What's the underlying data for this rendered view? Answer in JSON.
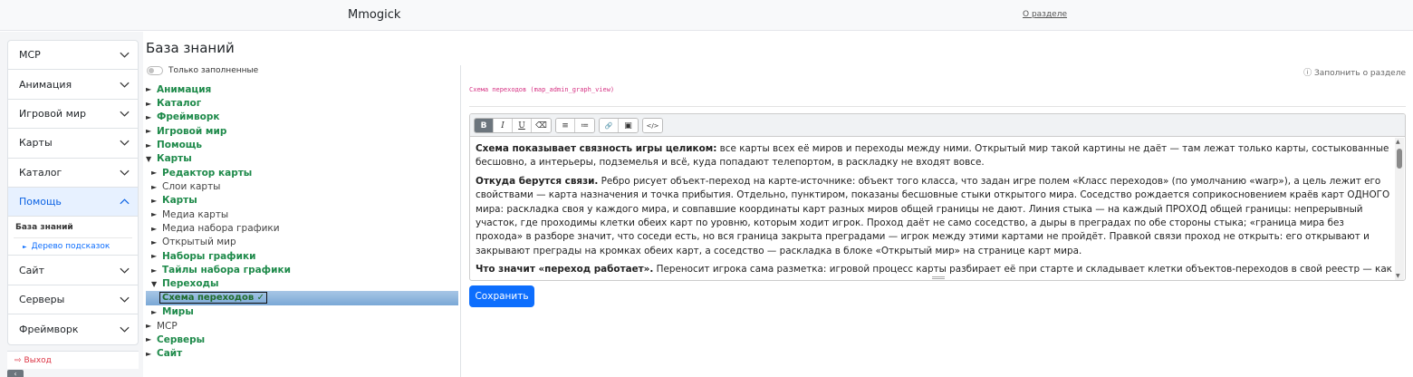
{
  "header": {
    "brand": "Mmogick",
    "about_link": "О разделе"
  },
  "sidebar": {
    "items_top": [
      {
        "label": "MCP",
        "name": "mcp"
      },
      {
        "label": "Анимация",
        "name": "animation"
      },
      {
        "label": "Игровой мир",
        "name": "game-world"
      },
      {
        "label": "Карты",
        "name": "maps"
      },
      {
        "label": "Каталог",
        "name": "catalog"
      }
    ],
    "open_item": {
      "label": "Помощь"
    },
    "open_children": {
      "knowledge_base": "База знаний",
      "tree_hint": "Дерево подсказок"
    },
    "items_bottom": [
      {
        "label": "Сайт",
        "name": "site"
      },
      {
        "label": "Серверы",
        "name": "servers"
      },
      {
        "label": "Фреймворк",
        "name": "framework"
      }
    ],
    "logout": "Выход"
  },
  "page": {
    "title": "База знаний",
    "filter_label": "Только заполненные",
    "fill_about": "Заполнить о разделе"
  },
  "tree": [
    {
      "label": "Анимация",
      "arrow": "►",
      "level": 1,
      "bold": true
    },
    {
      "label": "Каталог",
      "arrow": "►",
      "level": 1,
      "bold": true
    },
    {
      "label": "Фреймворк",
      "arrow": "►",
      "level": 1,
      "bold": true
    },
    {
      "label": "Игровой мир",
      "arrow": "►",
      "level": 1,
      "bold": true
    },
    {
      "label": "Помощь",
      "arrow": "►",
      "level": 1,
      "bold": true
    },
    {
      "label": "Карты",
      "arrow": "▼",
      "level": 1,
      "bold": true
    },
    {
      "label": "Редактор карты",
      "arrow": "►",
      "level": 2,
      "bold": true
    },
    {
      "label": "Слои карты",
      "arrow": "►",
      "level": 2,
      "bold": false
    },
    {
      "label": "Карты",
      "arrow": "►",
      "level": 2,
      "bold": true
    },
    {
      "label": "Медиа карты",
      "arrow": "►",
      "level": 2,
      "bold": false
    },
    {
      "label": "Медиа набора графики",
      "arrow": "►",
      "level": 2,
      "bold": false
    },
    {
      "label": "Открытый мир",
      "arrow": "►",
      "level": 2,
      "bold": false
    },
    {
      "label": "Наборы графики",
      "arrow": "►",
      "level": 2,
      "bold": true
    },
    {
      "label": "Тайлы набора графики",
      "arrow": "►",
      "level": 2,
      "bold": true
    },
    {
      "label": "Переходы",
      "arrow": "▼",
      "level": 2,
      "bold": true
    },
    {
      "label": "Схема переходов ✓",
      "arrow": "",
      "level": 3,
      "bold": true,
      "selected": true
    },
    {
      "label": "Миры",
      "arrow": "►",
      "level": 2,
      "bold": true
    },
    {
      "label": "MCP",
      "arrow": "►",
      "level": 1,
      "bold": false
    },
    {
      "label": "Серверы",
      "arrow": "►",
      "level": 1,
      "bold": true
    },
    {
      "label": "Сайт",
      "arrow": "►",
      "level": 1,
      "bold": true
    }
  ],
  "editor": {
    "schema_label": "Схема переходов (map_admin_graph_view)",
    "toolbar": [
      "B",
      "I",
      "U",
      "⌫",
      "≡",
      "≔",
      "🔗",
      "▣",
      "</>"
    ],
    "paragraphs": [
      {
        "lead": "Схема показывает связность игры целиком:",
        "text": " все карты всех её миров и переходы между ними. Открытый мир такой картины не даёт — там лежат только карты, состыкованные бесшовно, а интерьеры, подземелья и всё, куда попадают телепортом, в раскладку не входят вовсе."
      },
      {
        "lead": "Откуда берутся связи.",
        "text": " Ребро рисует объект-переход на карте-источнике: объект того класса, что задан игре полем «Класс переходов» (по умолчанию «warp»), а цель лежит его свойствами — карта назначения и точка прибытия. Отдельно, пунктиром, показаны бесшовные стыки открытого мира. Соседство рождается соприкосновением краёв карт ОДНОГО мира: раскладка своя у каждого мира, и совпавшие координаты карт разных миров общей границы не дают. Линия стыка — на каждый ПРОХОД общей границы: непрерывный участок, где проходимы клетки обеих карт по уровню, которым ходит игрок. Проход даёт не само соседство, а дыры в преградах по обе стороны стыка; «граница мира без прохода» в разборе значит, что соседи есть, но вся граница закрыта преградами — игрок между этими картами не пройдёт. Правкой связи проход не открыть: его открывают и закрывают преграды на кромках обеих карт, а соседство — раскладка в блоке «Открытый мир» на странице карт мира."
      },
      {
        "lead": "Что значит «переход работает».",
        "text": " Переносит игрока сама разметка: игровой процесс карты разбирает её при старте и складывает клетки объектов-переходов в свой реестр — как только"
      }
    ],
    "save_label": "Сохранить"
  }
}
